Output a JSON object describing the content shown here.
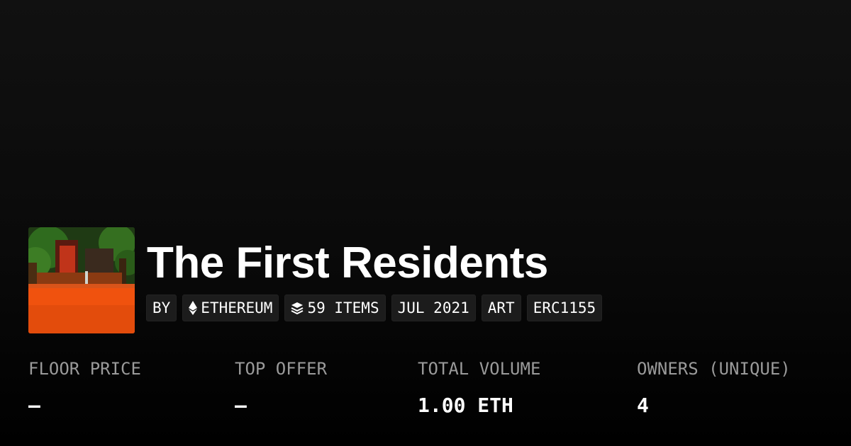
{
  "collection": {
    "title": "The First Residents",
    "avatar_icon": "collection-avatar-image"
  },
  "tags": [
    {
      "label": "BY"
    },
    {
      "label": "ETHEREUM",
      "icon": "ethereum-icon"
    },
    {
      "label": "59 ITEMS",
      "icon": "layers-icon"
    },
    {
      "label": "JUL 2021"
    },
    {
      "label": "ART"
    },
    {
      "label": "ERC1155"
    }
  ],
  "stats": [
    {
      "label": "FLOOR PRICE",
      "value": "–"
    },
    {
      "label": "TOP OFFER",
      "value": "–"
    },
    {
      "label": "TOTAL VOLUME",
      "value": "1.00 ETH"
    },
    {
      "label": "OWNERS (UNIQUE)",
      "value": "4"
    }
  ],
  "colors": {
    "background": "#0b0b0b",
    "tag_background": "#1c1c1c",
    "label_gray": "#9a9a9a",
    "text": "#ffffff"
  }
}
